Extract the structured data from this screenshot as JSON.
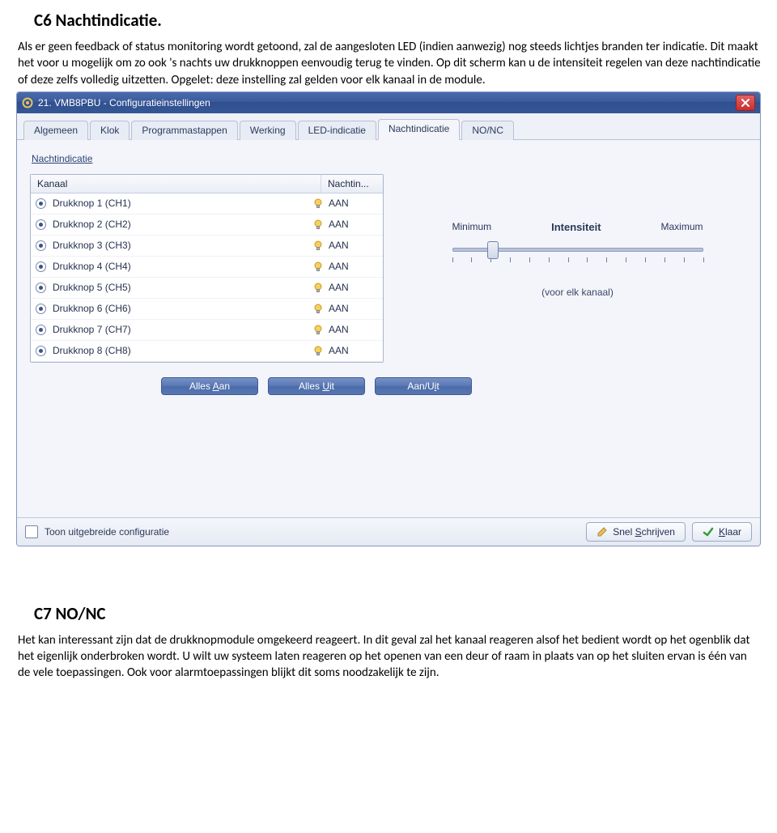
{
  "doc": {
    "sectionC6_title": "C6  Nachtindicatie.",
    "sectionC6_para": "Als er geen feedback of status monitoring wordt getoond, zal de aangesloten LED (indien aanwezig) nog steeds lichtjes branden ter indicatie. Dit maakt het voor u mogelijk om zo ook 's nachts uw drukknoppen eenvoudig terug te vinden. Op dit scherm kan u de intensiteit regelen van deze nachtindicatie of deze zelfs volledig uitzetten. Opgelet: deze instelling zal gelden voor elk kanaal in de module.",
    "sectionC7_title": "C7  NO/NC",
    "sectionC7_para": "Het kan interessant zijn dat de drukknopmodule omgekeerd reageert. In dit geval zal het kanaal reageren alsof het bedient wordt op het ogenblik dat het eigenlijk onderbroken wordt. U wilt uw systeem laten reageren op het openen van een deur of raam in plaats van op het sluiten ervan is één van de vele toepassingen. Ook voor alarmtoepassingen blijkt dit soms noodzakelijk te zijn."
  },
  "window": {
    "title": "21. VMB8PBU - Configuratieinstellingen"
  },
  "tabs": [
    {
      "label": "Algemeen"
    },
    {
      "label": "Klok"
    },
    {
      "label": "Programmastappen"
    },
    {
      "label": "Werking"
    },
    {
      "label": "LED-indicatie"
    },
    {
      "label": "Nachtindicatie",
      "active": true
    },
    {
      "label": "NO/NC"
    }
  ],
  "section_label": "Nachtindicatie",
  "table": {
    "headers": {
      "kanaal": "Kanaal",
      "nachtin": "Nachtin..."
    },
    "rows": [
      {
        "kanaal": "Drukknop 1 (CH1)",
        "status": "AAN"
      },
      {
        "kanaal": "Drukknop 2 (CH2)",
        "status": "AAN"
      },
      {
        "kanaal": "Drukknop 3 (CH3)",
        "status": "AAN"
      },
      {
        "kanaal": "Drukknop 4 (CH4)",
        "status": "AAN"
      },
      {
        "kanaal": "Drukknop 5 (CH5)",
        "status": "AAN"
      },
      {
        "kanaal": "Drukknop 6 (CH6)",
        "status": "AAN"
      },
      {
        "kanaal": "Drukknop 7 (CH7)",
        "status": "AAN"
      },
      {
        "kanaal": "Drukknop 8 (CH8)",
        "status": "AAN"
      }
    ]
  },
  "slider": {
    "min_label": "Minimum",
    "mid_label": "Intensiteit",
    "max_label": "Maximum",
    "caption": "(voor elk kanaal)",
    "value_percent": 16
  },
  "buttons": {
    "alles_aan_pre": "Alles ",
    "alles_aan_u": "A",
    "alles_aan_post": "an",
    "alles_uit_pre": "Alles ",
    "alles_uit_u": "U",
    "alles_uit_post": "it",
    "aan_uit_pre": "Aan/U",
    "aan_uit_u": "i",
    "aan_uit_post": "t"
  },
  "footer": {
    "toggle_label": "Toon uitgebreide configuratie",
    "snel_pre": "Snel ",
    "snel_u": "S",
    "snel_post": "chrijven",
    "klaar_u": "K",
    "klaar_post": "laar"
  }
}
